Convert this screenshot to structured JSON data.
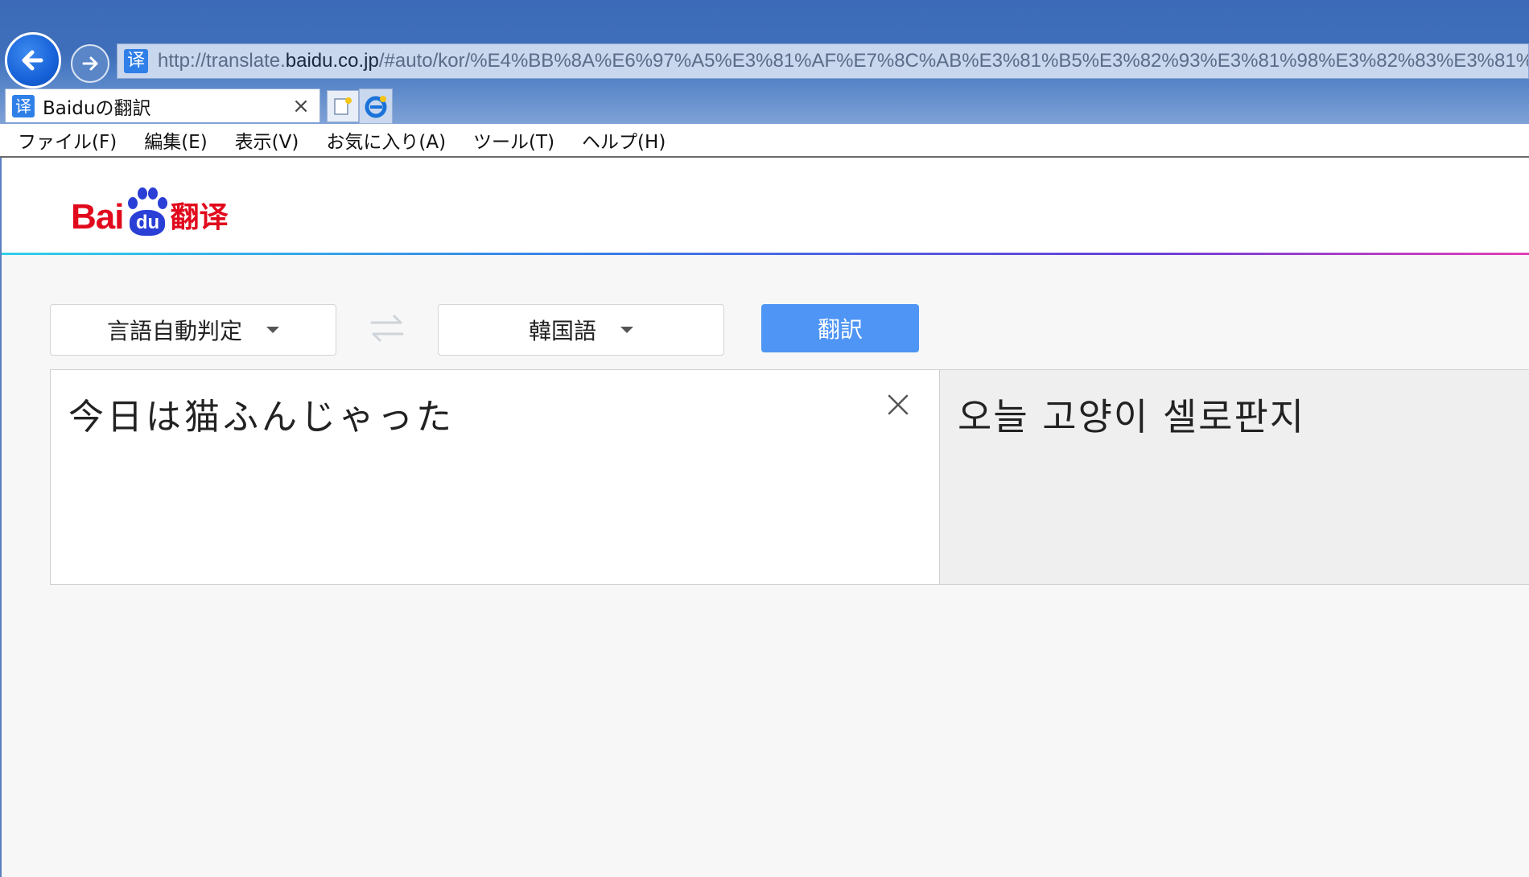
{
  "browser": {
    "url_prefix": "http://translate.",
    "url_domain": "baidu.co.jp",
    "url_rest": "/#auto/kor/%E4%BB%8A%E6%97%A5%E3%81%AF%E7%8C%AB%E3%81%B5%E3%82%93%E3%81%98%E3%82%83%E3%81%A3%E3%8",
    "favicon_glyph": "译",
    "tab_title": "Baiduの翻訳",
    "tab_close": "×"
  },
  "menubar": {
    "items": [
      "ファイル(F)",
      "編集(E)",
      "表示(V)",
      "お気に入り(A)",
      "ツール(T)",
      "ヘルプ(H)"
    ]
  },
  "logo": {
    "bai": "Bai",
    "du": "du",
    "fanyi": "翻译"
  },
  "translator": {
    "source_lang": "言語自動判定",
    "target_lang": "韓国語",
    "translate_label": "翻訳",
    "input_text": "今日は猫ふんじゃった",
    "output_text": "오늘 고양이 셀로판지"
  },
  "colors": {
    "accent_blue": "#4e95f5",
    "logo_red": "#e10a1d",
    "logo_blue": "#2a3fd6",
    "chrome_blue": "#3c6ab8"
  }
}
